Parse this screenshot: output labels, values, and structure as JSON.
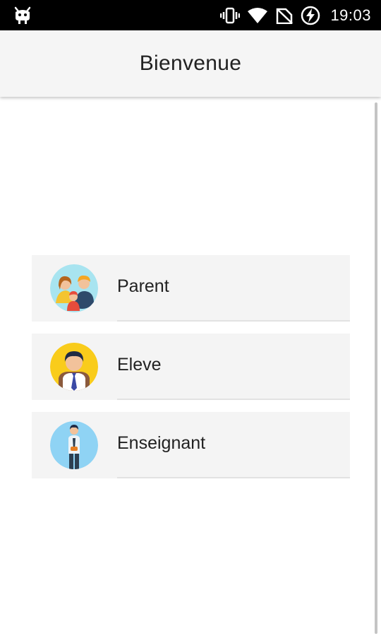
{
  "status_bar": {
    "time": "19:03",
    "icons": [
      "android-debug-icon",
      "vibrate-icon",
      "wifi-icon",
      "no-signal-icon",
      "battery-charging-icon"
    ]
  },
  "app_bar": {
    "title": "Bienvenue"
  },
  "roles": [
    {
      "label": "Parent",
      "icon": "family-avatar-icon",
      "avatar_color": "#a8e4f0"
    },
    {
      "label": "Eleve",
      "icon": "student-avatar-icon",
      "avatar_color": "#f9cc1b"
    },
    {
      "label": "Enseignant",
      "icon": "teacher-avatar-icon",
      "avatar_color": "#8fd3f4"
    }
  ],
  "colors": {
    "status_bar": "#000000",
    "app_bar": "#f5f5f5",
    "card": "#f4f4f4",
    "text": "#222222"
  }
}
